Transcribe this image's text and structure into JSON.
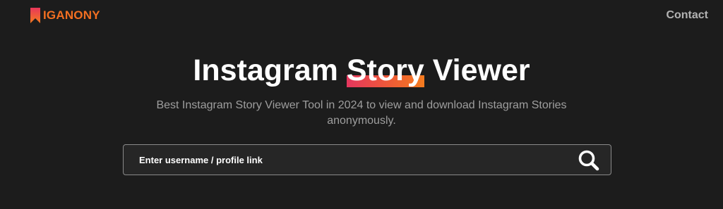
{
  "header": {
    "logo_text": "IGANONY",
    "logo_icon": "bookmark-logo-icon",
    "contact_label": "Contact"
  },
  "hero": {
    "title_before": "Instagram ",
    "title_highlight": "Story",
    "title_after": " Viewer",
    "subtitle": "Best Instagram Story Viewer Tool in 2024 to view and download Instagram Stories anonymously."
  },
  "search": {
    "placeholder": "Enter username / profile link",
    "value": "",
    "button_icon": "search-icon"
  },
  "colors": {
    "background": "#1c1c1c",
    "brand_orange": "#f36f21",
    "highlight_start": "#e4365e",
    "highlight_end": "#f47b1f",
    "muted_text": "#9e9e9e"
  }
}
